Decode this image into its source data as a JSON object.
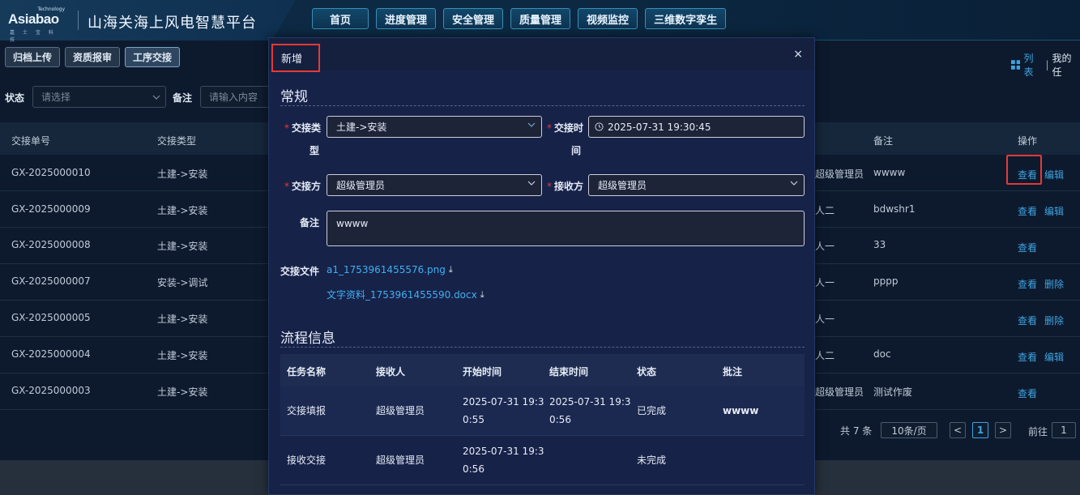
{
  "header": {
    "brand": "Asiabao",
    "brand_tech": "Technology",
    "brand_sub": "嘉 士 宝 科 技",
    "app_title": "山海关海上风电智慧平台",
    "nav": [
      "首页",
      "进度管理",
      "安全管理",
      "质量管理",
      "视频监控",
      "三维数字孪生"
    ]
  },
  "toolbar": {
    "buttons": [
      "归档上传",
      "资质报审",
      "工序交接"
    ],
    "view_list": "列表",
    "view_sep": "|",
    "view_mine": "我的任"
  },
  "filters": {
    "status_label": "状态",
    "status_placeholder": "请选择",
    "remark_label": "备注",
    "remark_placeholder": "请输入内容"
  },
  "table": {
    "headers": {
      "no": "交接单号",
      "type": "交接类型",
      "remark": "备注",
      "ops": "操作"
    },
    "rows": [
      {
        "no": "GX-2025000010",
        "type": "土建->安装",
        "person": "超级管理员",
        "remark": "wwww",
        "ops": [
          "查看",
          "编辑"
        ]
      },
      {
        "no": "GX-2025000009",
        "type": "土建->安装",
        "person": "人二",
        "remark": "bdwshr1",
        "ops": [
          "查看",
          "编辑"
        ]
      },
      {
        "no": "GX-2025000008",
        "type": "土建->安装",
        "person": "人一",
        "remark": "33",
        "ops": [
          "查看"
        ]
      },
      {
        "no": "GX-2025000007",
        "type": "安装->调试",
        "person": "人一",
        "remark": "pppp",
        "ops": [
          "查看",
          "删除"
        ]
      },
      {
        "no": "GX-2025000005",
        "type": "土建->安装",
        "person": "人一",
        "remark": "",
        "ops": [
          "查看",
          "删除"
        ]
      },
      {
        "no": "GX-2025000004",
        "type": "土建->安装",
        "person": "人二",
        "remark": "doc",
        "ops": [
          "查看",
          "编辑"
        ]
      },
      {
        "no": "GX-2025000003",
        "type": "土建->安装",
        "person": "超级管理员",
        "remark": "测试作废",
        "ops": [
          "查看"
        ]
      }
    ]
  },
  "pagination": {
    "total": "共 7 条",
    "page_size": "10条/页",
    "prev": "<",
    "current": "1",
    "next": ">",
    "goto_label": "前往",
    "goto_value": "1"
  },
  "modal": {
    "title": "新增",
    "close": "×",
    "section_general": "常规",
    "type_label_1": "交接类",
    "type_label_2": "型",
    "type_value": "土建->安装",
    "time_label_1": "交接时",
    "time_label_2": "间",
    "time_value": "2025-07-31 19:30:45",
    "from_label": "交接方",
    "from_value": "超级管理员",
    "to_label": "接收方",
    "to_value": "超级管理员",
    "remark_label": "备注",
    "remark_value": "wwww",
    "files_label": "交接文件",
    "files": [
      "a1_1753961455576.png",
      "文字资料_1753961455590.docx"
    ],
    "section_flow": "流程信息",
    "flow_headers": [
      "任务名称",
      "接收人",
      "开始时间",
      "结束时间",
      "状态",
      "批注"
    ],
    "flow_rows": [
      {
        "task": "交接填报",
        "receiver": "超级管理员",
        "start_1": "2025-07-31 19:3",
        "start_2": "0:55",
        "end_1": "2025-07-31 19:3",
        "end_2": "0:56",
        "status": "已完成",
        "note": "wwww"
      },
      {
        "task": "接收交接",
        "receiver": "超级管理员",
        "start_1": "2025-07-31 19:3",
        "start_2": "0:56",
        "end_1": "",
        "end_2": "",
        "status": "未完成",
        "note": ""
      }
    ]
  },
  "colors": {
    "accent": "#3fa3e0",
    "highlight": "#e53935",
    "modal_bg": "#172249"
  }
}
